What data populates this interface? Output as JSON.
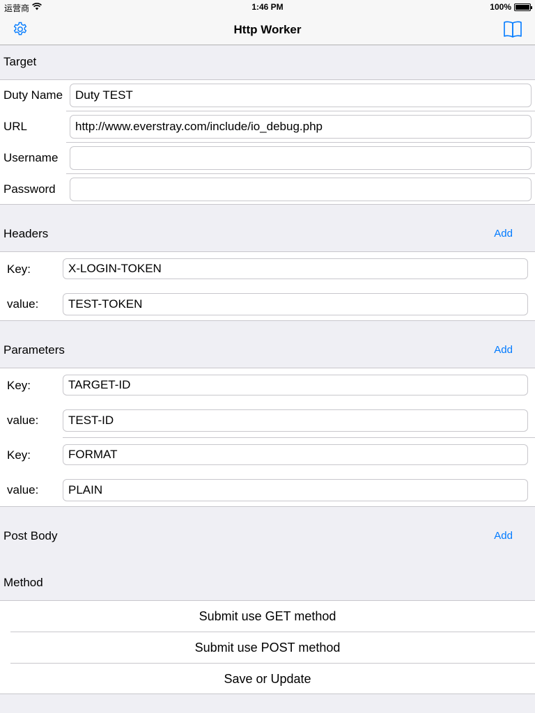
{
  "status": {
    "carrier": "运营商",
    "time": "1:46 PM",
    "battery": "100%"
  },
  "nav": {
    "title": "Http Worker",
    "left_icon": "gear-icon",
    "right_icon": "book-icon"
  },
  "target": {
    "header": "Target",
    "duty_name_label": "Duty Name",
    "duty_name_value": "Duty TEST",
    "url_label": "URL",
    "url_value": "http://www.everstray.com/include/io_debug.php",
    "username_label": "Username",
    "username_value": "",
    "password_label": "Password",
    "password_value": ""
  },
  "headers": {
    "header": "Headers",
    "add": "Add",
    "items": [
      {
        "key_label": "Key:",
        "key": "X-LOGIN-TOKEN",
        "value_label": "value:",
        "value": "TEST-TOKEN"
      }
    ]
  },
  "parameters": {
    "header": "Parameters",
    "add": "Add",
    "items": [
      {
        "key_label": "Key:",
        "key": "TARGET-ID",
        "value_label": "value:",
        "value": "TEST-ID"
      },
      {
        "key_label": "Key:",
        "key": "FORMAT",
        "value_label": "value:",
        "value": "PLAIN"
      }
    ]
  },
  "post_body": {
    "header": "Post Body",
    "add": "Add"
  },
  "method": {
    "header": "Method",
    "get": "Submit use GET method",
    "post": "Submit use POST method",
    "save": "Save or Update"
  },
  "colors": {
    "accent": "#007aff",
    "background": "#efeff4",
    "separator": "#c8c7cc"
  }
}
